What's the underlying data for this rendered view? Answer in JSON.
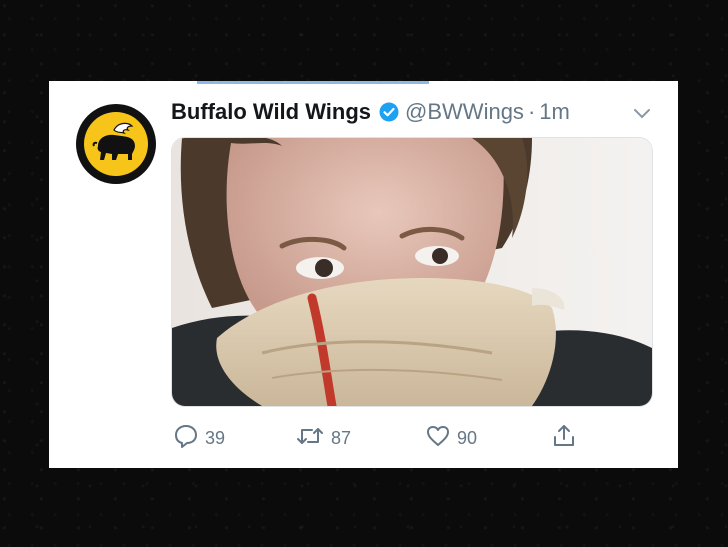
{
  "tweet": {
    "display_name": "Buffalo Wild Wings",
    "handle": "@BWWings",
    "separator": "·",
    "time": "1m",
    "avatar_icon": "buffalo-logo-icon",
    "verified_icon": "verified-badge-icon",
    "menu_icon": "chevron-down-icon",
    "media": {
      "description_icon": "photo-person-icon"
    }
  },
  "actions": {
    "reply": {
      "icon": "reply-icon",
      "count": "39"
    },
    "retweet": {
      "icon": "retweet-icon",
      "count": "87"
    },
    "like": {
      "icon": "heart-icon",
      "count": "90"
    },
    "share": {
      "icon": "share-icon"
    }
  },
  "colors": {
    "brand_yellow": "#f7c51a",
    "verified_blue": "#1da1f2",
    "muted_text": "#657786",
    "name_text": "#14171a"
  }
}
